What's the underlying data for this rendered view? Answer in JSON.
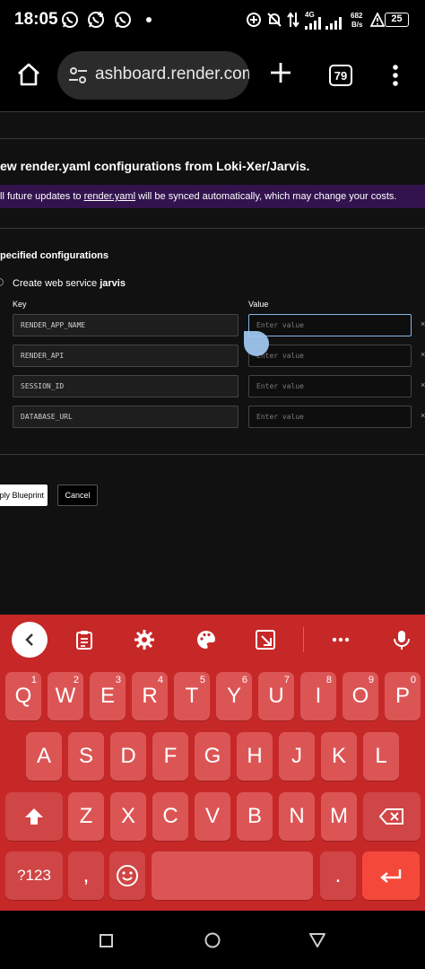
{
  "status_bar": {
    "time": "18:05",
    "network": "4G",
    "speed_value": "682",
    "speed_unit": "B/s",
    "battery": "25"
  },
  "browser": {
    "url": "ashboard.render.com",
    "tab_count": "79",
    "icons": [
      "home-icon",
      "tune-icon",
      "plus-icon",
      "tabs-icon",
      "more-vert-icon"
    ]
  },
  "page": {
    "title": "ew render.yaml configurations from Loki-Xer/Jarvis.",
    "banner_prefix": "ll future updates to ",
    "banner_link": "render.yaml",
    "banner_suffix": " will be synced automatically, which may change your costs.",
    "section_title": "pecified configurations",
    "service_prefix": "Create web service ",
    "service_name": "jarvis",
    "key_header": "Key",
    "value_header": "Value",
    "env_vars": [
      {
        "key": "RENDER_APP_NAME",
        "placeholder": "Enter value"
      },
      {
        "key": "RENDER_API",
        "placeholder": "Enter value"
      },
      {
        "key": "SESSION_ID",
        "placeholder": "Enter value"
      },
      {
        "key": "DATABASE_URL",
        "placeholder": "Enter value"
      }
    ],
    "apply_button": "ply Blueprint",
    "cancel_button": "Cancel",
    "remove_mark": "×"
  },
  "keyboard": {
    "row1": [
      {
        "key": "Q",
        "hint": "1"
      },
      {
        "key": "W",
        "hint": "2"
      },
      {
        "key": "E",
        "hint": "3"
      },
      {
        "key": "R",
        "hint": "4"
      },
      {
        "key": "T",
        "hint": "5"
      },
      {
        "key": "Y",
        "hint": "6"
      },
      {
        "key": "U",
        "hint": "7"
      },
      {
        "key": "I",
        "hint": "8"
      },
      {
        "key": "O",
        "hint": "9"
      },
      {
        "key": "P",
        "hint": "0"
      }
    ],
    "row2": [
      "A",
      "S",
      "D",
      "F",
      "G",
      "H",
      "J",
      "K",
      "L"
    ],
    "row3": [
      "Z",
      "X",
      "C",
      "V",
      "B",
      "N",
      "M"
    ],
    "symbols_key": "?123",
    "comma_key": ",",
    "period_key": ".",
    "toolbar_icons": [
      "back-arrow-icon",
      "clipboard-icon",
      "settings-gear-icon",
      "palette-icon",
      "resize-icon",
      "more-horiz-icon",
      "microphone-icon"
    ],
    "theme_color": "#c62828"
  }
}
